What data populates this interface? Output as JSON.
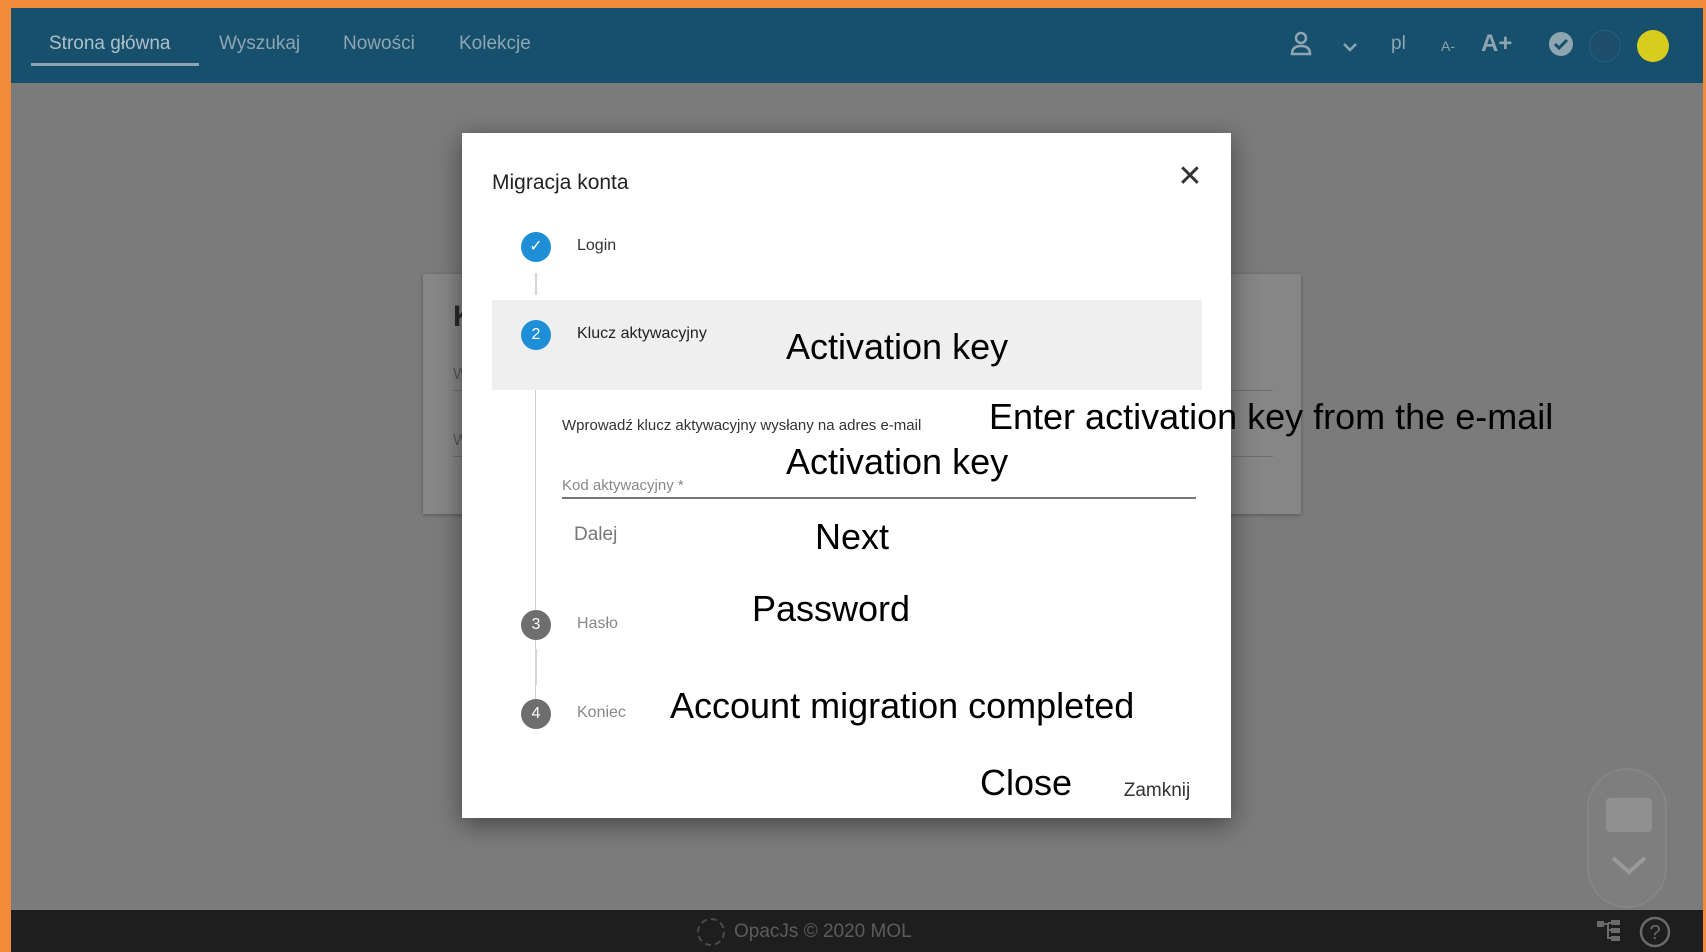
{
  "nav": {
    "links": [
      "Strona główna",
      "Wyszukaj",
      "Nowości",
      "Kolekcje"
    ],
    "lang": "pl",
    "font_smaller": "A-",
    "font_larger": "A+"
  },
  "bg_card": {
    "title": "Ka",
    "field1": "Wo",
    "field2": "Wy"
  },
  "modal": {
    "title": "Migracja konta",
    "close_glyph": "✕",
    "steps": [
      {
        "number": "✓",
        "label": "Login",
        "state": "done"
      },
      {
        "number": "2",
        "label": "Klucz aktywacyjny",
        "state": "active"
      },
      {
        "number": "3",
        "label": "Hasło",
        "state": "pending"
      },
      {
        "number": "4",
        "label": "Koniec",
        "state": "pending"
      }
    ],
    "description": "Wprowadź klucz aktywacyjny wysłany na adres e-mail",
    "input_placeholder": "Kod aktywacyjny *",
    "next_button": "Dalej",
    "close_button": "Zamknij"
  },
  "overlays": {
    "activation_key_1": "Activation key",
    "enter_key": "Enter activation key from the e-mail",
    "activation_key_2": "Activation key",
    "next": "Next",
    "password": "Password",
    "completed": "Account migration completed",
    "close": "Close"
  },
  "footer": {
    "text": "OpacJs © 2020 MOL"
  },
  "colors": {
    "navbar": "#16506c",
    "accent": "#1e8fd6",
    "frame_border": "#f28a3c",
    "dot1": "#1d4e6b",
    "dot2": "#d8cc1e"
  }
}
